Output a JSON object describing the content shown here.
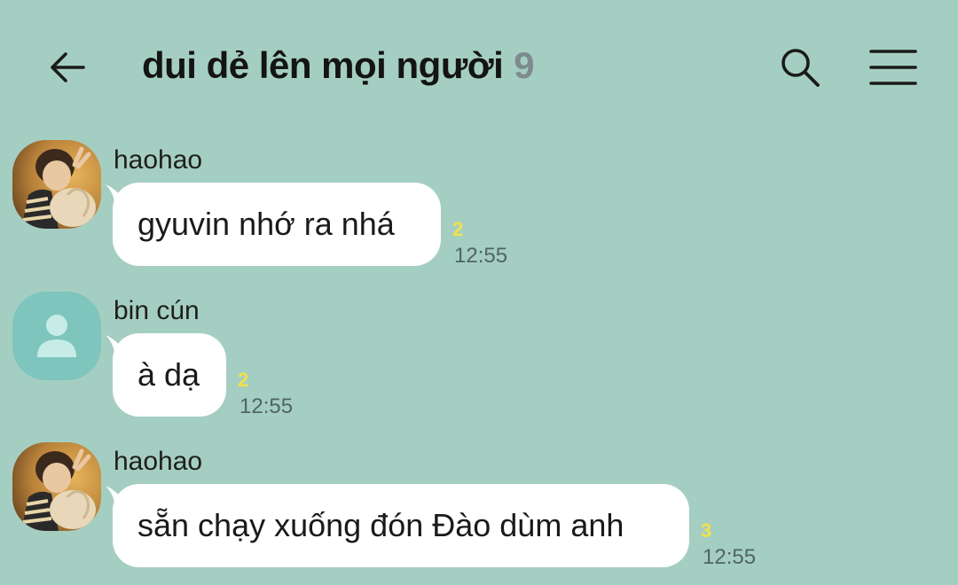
{
  "header": {
    "title": "dui dẻ lên mọi người",
    "member_count": "9",
    "back_icon": "back-arrow-icon",
    "search_icon": "search-icon",
    "menu_icon": "hamburger-menu-icon"
  },
  "colors": {
    "background": "#a5cec2",
    "bubble": "#ffffff",
    "unread": "#f2e14a",
    "member_count": "#7d8a8e",
    "default_avatar": "#7ec5bd"
  },
  "messages": [
    {
      "sender": "haohao",
      "text": "gyuvin nhớ ra nhá",
      "unread": "2",
      "time": "12:55",
      "avatar": "photo-avatar"
    },
    {
      "sender": "bin cún",
      "text": "à dạ",
      "unread": "2",
      "time": "12:55",
      "avatar": "default-person-icon"
    },
    {
      "sender": "haohao",
      "text": "sẵn chạy xuống đón Đào dùm anh",
      "unread": "3",
      "time": "12:55",
      "avatar": "photo-avatar"
    }
  ]
}
